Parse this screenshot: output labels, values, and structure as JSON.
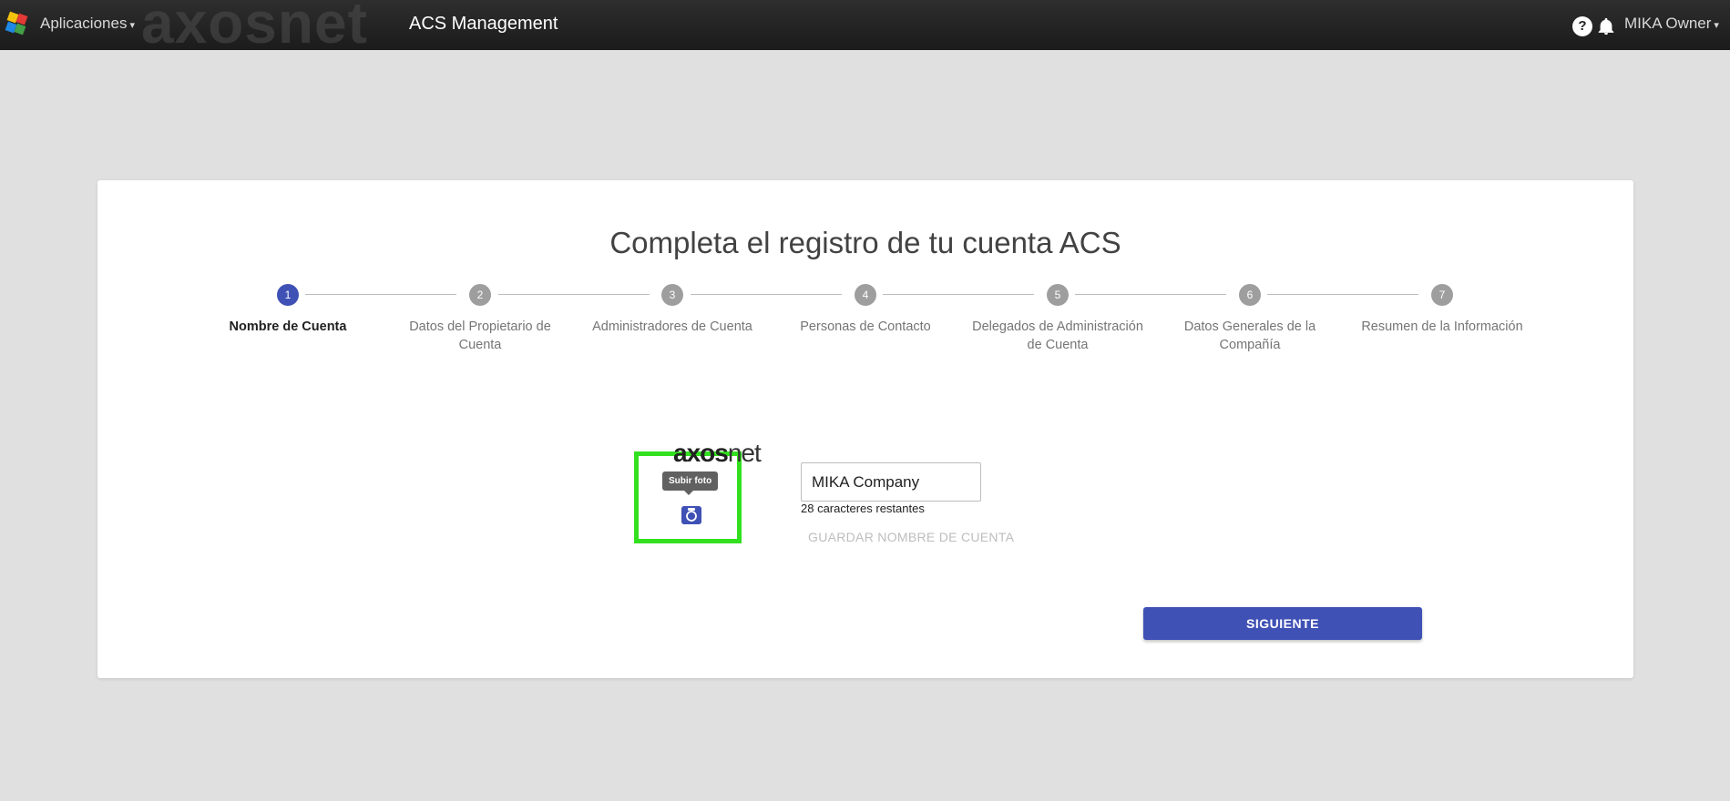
{
  "topbar": {
    "apps_label": "Aplicaciones",
    "brand_logo_text": "axosnet",
    "app_title": "ACS Management",
    "help_symbol": "?",
    "user_label": "MIKA Owner",
    "icons": {
      "app": "app-icon",
      "help": "help-icon",
      "notifications": "bell-icon"
    }
  },
  "main": {
    "title": "Completa el registro de tu cuenta ACS",
    "steps": [
      {
        "number": "1",
        "label": "Nombre de Cuenta",
        "active": true
      },
      {
        "number": "2",
        "label": "Datos del Propietario de Cuenta",
        "active": false
      },
      {
        "number": "3",
        "label": "Administradores de Cuenta",
        "active": false
      },
      {
        "number": "4",
        "label": "Personas de Contacto",
        "active": false
      },
      {
        "number": "5",
        "label": "Delegados de Administración de Cuenta",
        "active": false
      },
      {
        "number": "6",
        "label": "Datos Generales de la Compañía",
        "active": false
      },
      {
        "number": "7",
        "label": "Resumen de la Información",
        "active": false
      }
    ],
    "photo": {
      "tooltip": "Subir foto",
      "logo_bold": "axos",
      "logo_rest": "net"
    },
    "account_name": {
      "value": "MIKA Company",
      "remaining": "28 caracteres restantes",
      "save_label": "GUARDAR NOMBRE DE CUENTA"
    },
    "next_label": "SIGUIENTE"
  },
  "colors": {
    "primary": "#3f51b5",
    "highlight": "#33e01f",
    "topbar": "#222222",
    "background": "#e0e0e0"
  }
}
